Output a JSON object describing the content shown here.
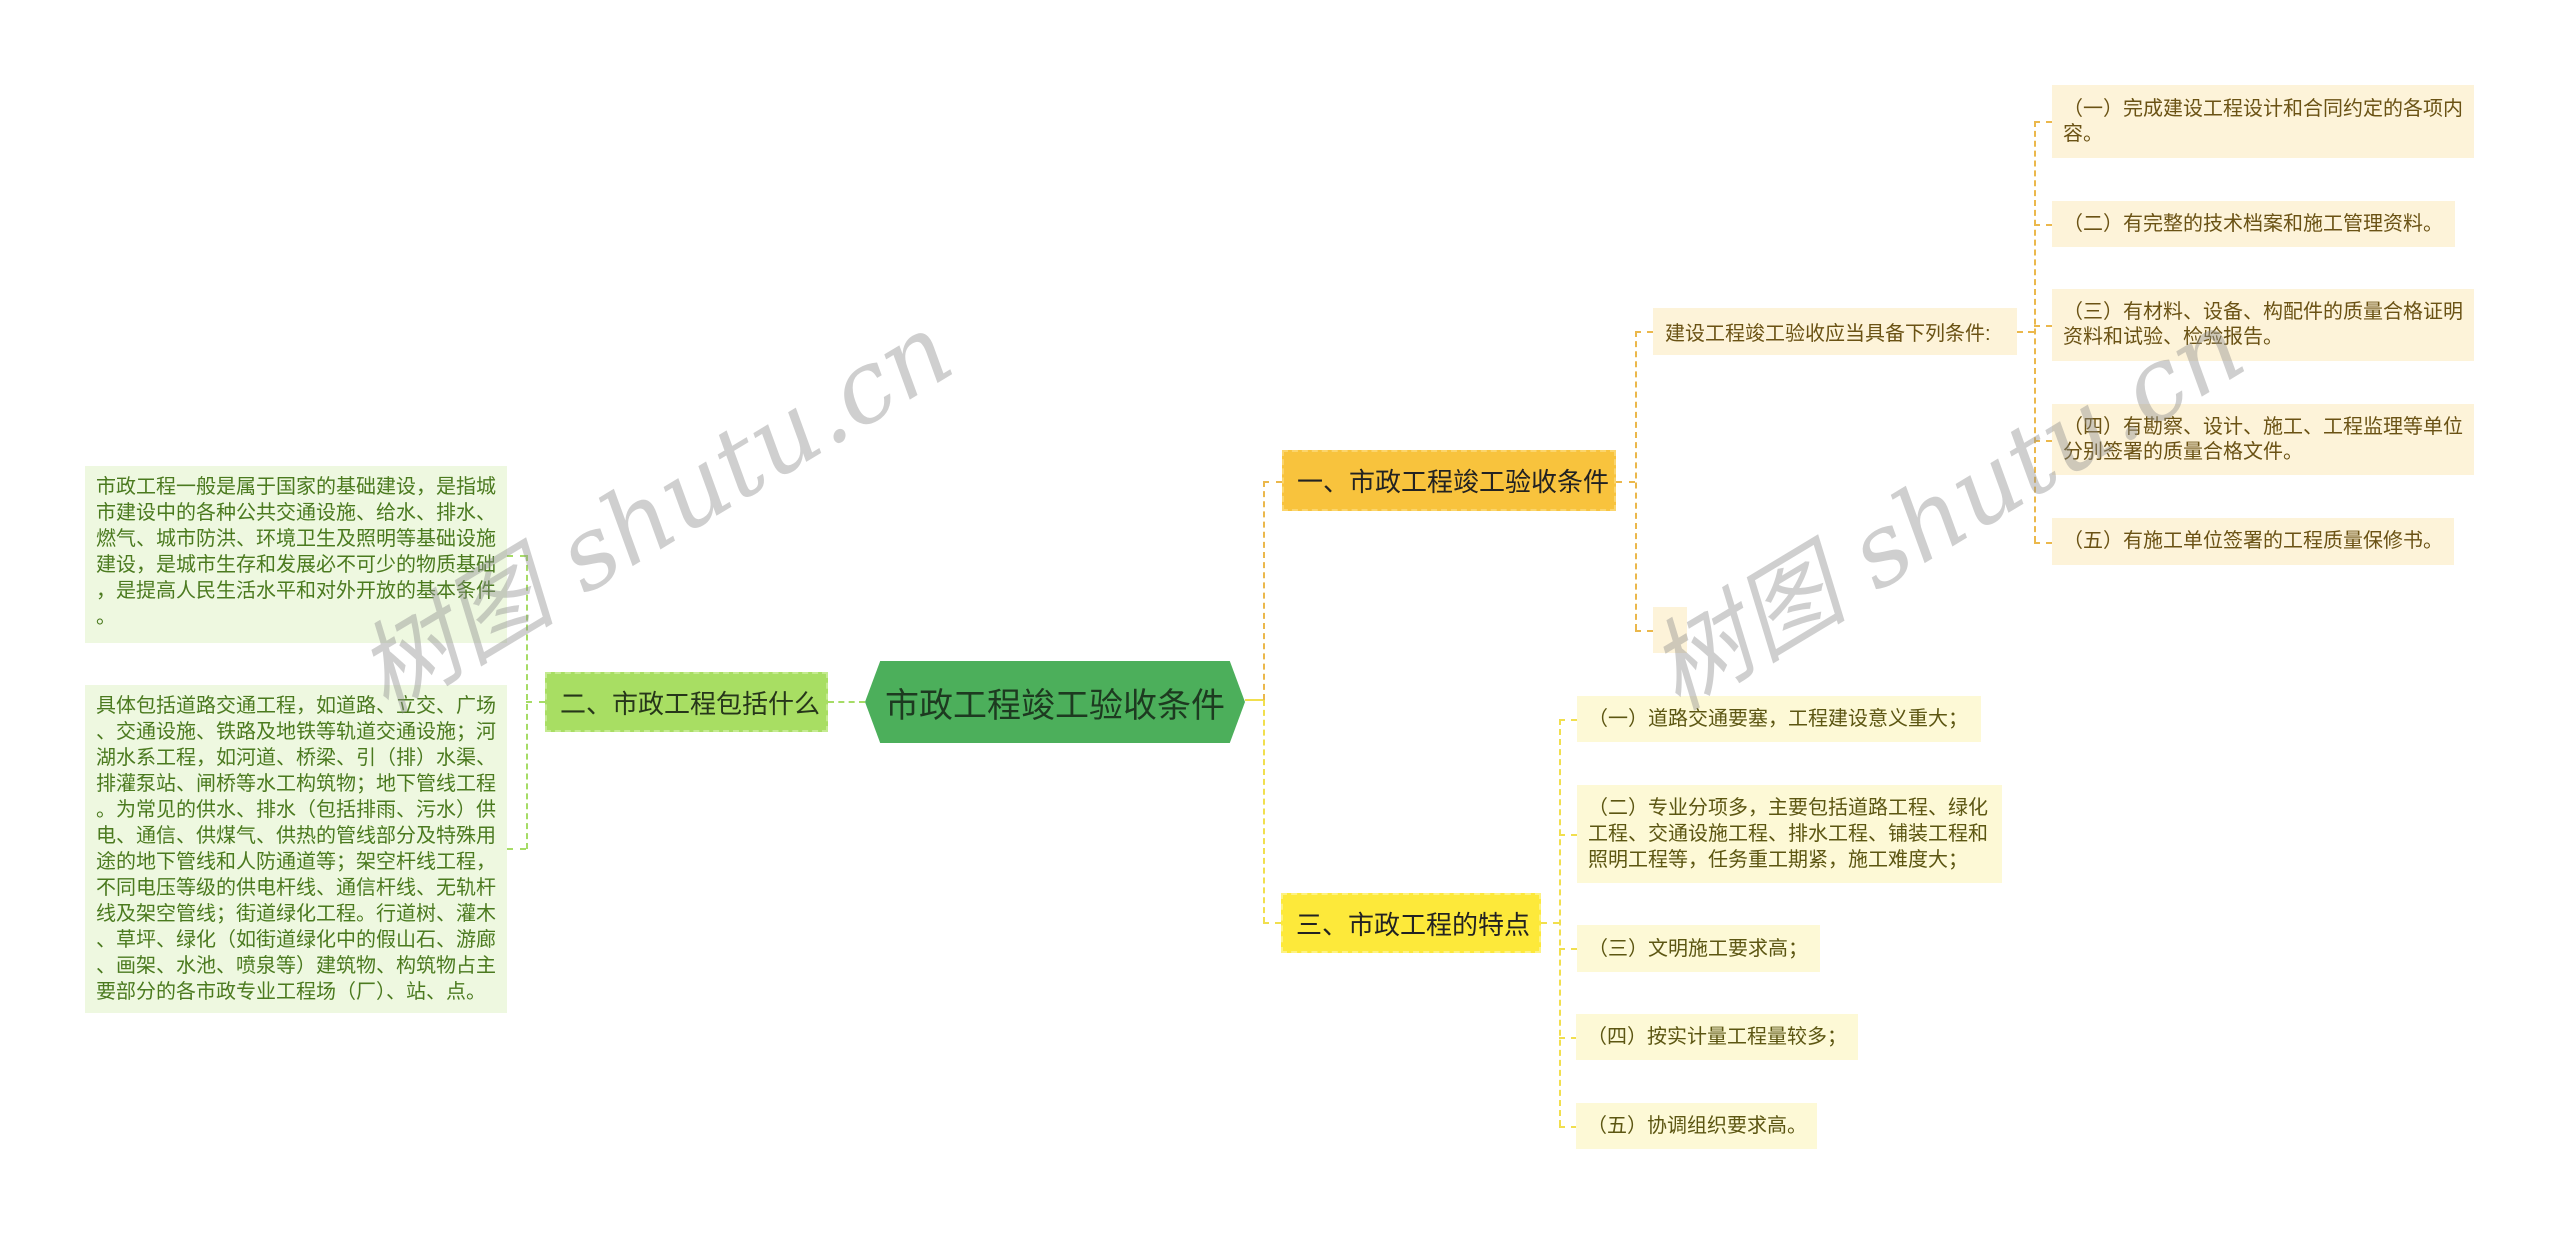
{
  "watermark": "树图 shutu.cn",
  "theme": {
    "root_fill": "#4caf5b",
    "branch_left_fill": "#a8de63",
    "branch_left_line": "#a6dc66",
    "left_leaf_fill": "#eef8e0",
    "left_leaf_text": "#4b7a1f",
    "branch1_fill": "#f8c33d",
    "branch1_line": "#ebb84c",
    "branch1_leaf_fill": "#fdf3d9",
    "branch1_leaf_text": "#6a5214",
    "branch3_fill": "#fde93a",
    "branch3_line": "#f1df4e",
    "branch3_leaf_fill": "#fdf9d6",
    "branch3_leaf_text": "#5c5612"
  },
  "root": {
    "label": "市政工程竣工验收条件"
  },
  "branch_what": {
    "label": "二、市政工程包括什么",
    "notes": [
      {
        "lines": [
          "市政工程一般是属于国家的基础建设，是指城",
          "市建设中的各种公共交通设施、给水、排水、",
          "燃气、城市防洪、环境卫生及照明等基础设施",
          "建设，是城市生存和发展必不可少的物质基础",
          "，是提高人民生活水平和对外开放的基本条件",
          "。"
        ]
      },
      {
        "lines": [
          "具体包括道路交通工程，如道路、立交、广场",
          "、交通设施、铁路及地铁等轨道交通设施；河",
          "湖水系工程，如河道、桥梁、引（排）水渠、",
          "排灌泵站、闸桥等水工构筑物；地下管线工程",
          "。为常见的供水、排水（包括排雨、污水）供",
          "电、通信、供煤气、供热的管线部分及特殊用",
          "途的地下管线和人防通道等；架空杆线工程，",
          "不同电压等级的供电杆线、通信杆线、无轨杆",
          "线及架空管线；街道绿化工程。行道树、灌木",
          "、草坪、绿化（如街道绿化中的假山石、游廊",
          "、画架、水池、喷泉等）建筑物、构筑物占主",
          "要部分的各市政专业工程场（厂）、站、点。"
        ]
      }
    ]
  },
  "branch_conditions": {
    "label": "一、市政工程竣工验收条件",
    "sub": {
      "label": "建设工程竣工验收应当具备下列条件:",
      "items": [
        {
          "lines": [
            "（一）完成建设工程设计和合同约定的各项内",
            "容。"
          ]
        },
        {
          "lines": [
            "（二）有完整的技术档案和施工管理资料。"
          ]
        },
        {
          "lines": [
            "（三）有材料、设备、构配件的质量合格证明",
            "资料和试验、检验报告。"
          ]
        },
        {
          "lines": [
            "（四）有勘察、设计、施工、工程监理等单位",
            "分别签署的质量合格文件。"
          ]
        },
        {
          "lines": [
            "（五）有施工单位签署的工程质量保修书。"
          ]
        }
      ]
    },
    "empty_node": {
      "label": ""
    }
  },
  "branch_features": {
    "label": "三、市政工程的特点",
    "items": [
      {
        "lines": [
          "（一）道路交通要塞，工程建设意义重大；"
        ]
      },
      {
        "lines": [
          "（二）专业分项多，主要包括道路工程、绿化",
          "工程、交通设施工程、排水工程、铺装工程和",
          "照明工程等，任务重工期紧，施工难度大；"
        ]
      },
      {
        "lines": [
          "（三）文明施工要求高；"
        ]
      },
      {
        "lines": [
          "（四）按实计量工程量较多；"
        ]
      },
      {
        "lines": [
          "（五）协调组织要求高。"
        ]
      }
    ]
  }
}
